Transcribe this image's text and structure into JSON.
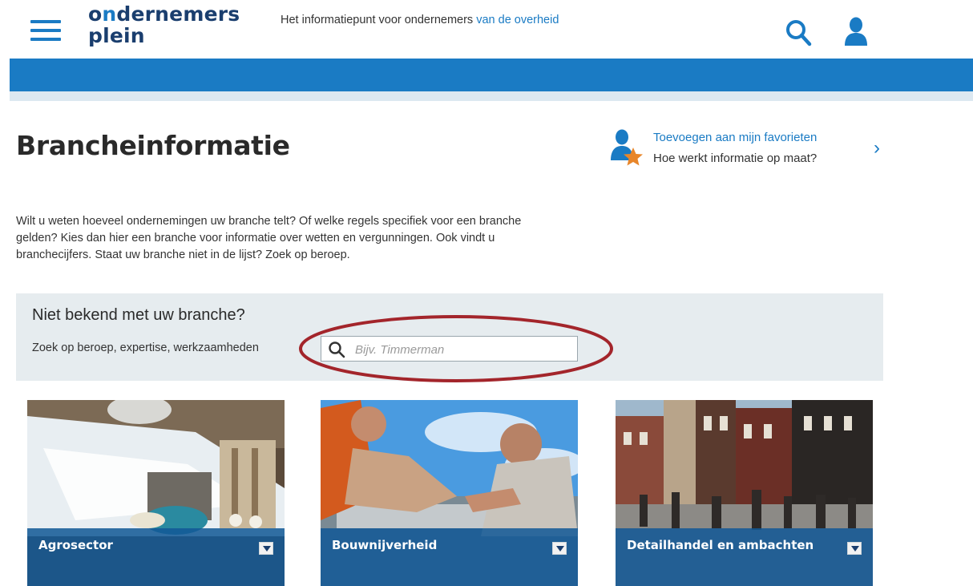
{
  "header": {
    "logo_line1_a": "o",
    "logo_line1_b": "n",
    "logo_line1_c": "dernemers",
    "logo_line2": "plein",
    "tagline_prefix": "Het informatiepunt voor ondernemers ",
    "tagline_link": "van de overheid",
    "menu_icon": "hamburger-menu-icon",
    "search_icon": "search-icon",
    "user_icon": "user-icon"
  },
  "page": {
    "title": "Brancheinformatie",
    "favorites_link": "Toevoegen aan mijn favorieten",
    "favorites_sub": "Hoe werkt informatie op maat?",
    "chevron": "›",
    "intro_line1": "Wilt u weten hoeveel ondernemingen uw branche telt? Of welke regels specifiek voor een branche",
    "intro_line2": "gelden? Kies dan hier een branche voor informatie over wetten en vergunningen. Ook vindt u",
    "intro_line3": "branchecijfers. Staat uw branche niet in de lijst? Zoek op beroep."
  },
  "search_panel": {
    "title": "Niet bekend met uw branche?",
    "label": "Zoek op beroep, expertise, werkzaamheden",
    "placeholder": "Bijv. Timmerman",
    "value": ""
  },
  "cards": [
    {
      "label": "Agrosector"
    },
    {
      "label": "Bouwnijverheid"
    },
    {
      "label": "Detailhandel en ambachten"
    }
  ],
  "colors": {
    "brand_blue": "#1a7bc4",
    "dark_navy": "#1a3e6e",
    "panel_bg": "#e6ecef",
    "highlight_ellipse": "#a3252b",
    "star_orange": "#e8862a"
  }
}
